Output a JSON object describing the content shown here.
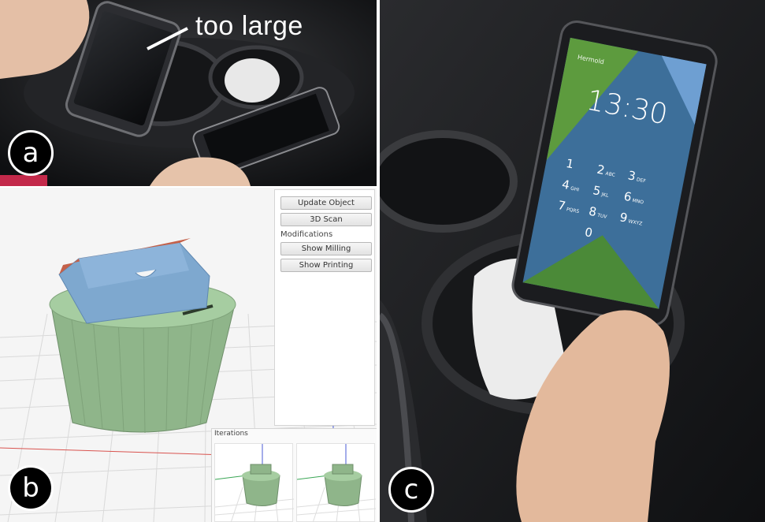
{
  "panels": {
    "a": {
      "badge": "a",
      "annotation": "too large"
    },
    "b": {
      "badge": "b",
      "buttons": {
        "update_object": "Update Object",
        "scan_3d": "3D Scan",
        "show_milling": "Show Milling",
        "show_printing": "Show Printing"
      },
      "modifications_label": "Modifications",
      "iterations_label": "Iterations",
      "colors": {
        "model_green": "#8fb58a",
        "holder_blue": "#7ea8cf",
        "inner_red": "#c4614a"
      }
    },
    "c": {
      "badge": "c",
      "phone_status": "Hermold",
      "phone_time": "13:30",
      "keypad": [
        "1",
        "2",
        "3",
        "4",
        "5",
        "6",
        "7",
        "8",
        "9",
        "0"
      ],
      "keypad_letters": [
        "ABC",
        "DEF",
        "GHI",
        "JKL",
        "MNO",
        "PQRS",
        "TUV",
        "WXYZ"
      ]
    }
  }
}
